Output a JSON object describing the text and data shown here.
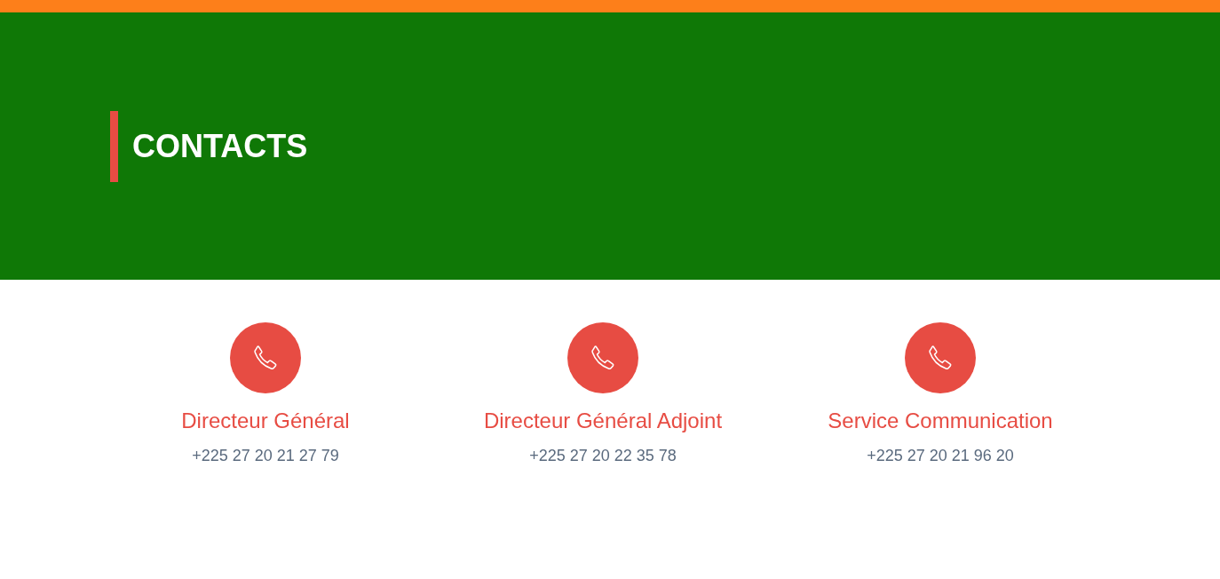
{
  "banner": {
    "title": "CONTACTS"
  },
  "contacts": [
    {
      "name": "Directeur Général",
      "phone": "+225 27 20 21 27 79"
    },
    {
      "name": "Directeur Général Adjoint",
      "phone": "+225 27 20 22 35 78"
    },
    {
      "name": "Service Communication",
      "phone": "+225 27 20 21 96 20"
    }
  ]
}
